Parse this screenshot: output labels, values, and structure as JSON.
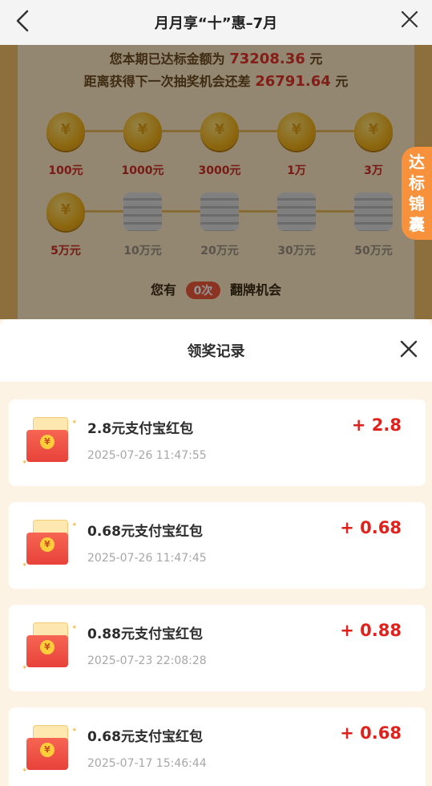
{
  "header": {
    "title": "月月享“十”惠–7月",
    "back_icon": "chevron-left-icon",
    "close_icon": "close-icon"
  },
  "progress": {
    "line1_prefix": "您本期已达标金额为",
    "line1_amount": "73208.36",
    "line1_suffix": "元",
    "line2_prefix": "距离获得下一次抽奖机会还差",
    "line2_amount": "26791.64",
    "line2_suffix": "元"
  },
  "milestones_row1": [
    {
      "label": "100元",
      "reached": true
    },
    {
      "label": "1000元",
      "reached": true
    },
    {
      "label": "3000元",
      "reached": true
    },
    {
      "label": "1万",
      "reached": true
    },
    {
      "label": "3万",
      "reached": true
    }
  ],
  "milestones_row2": [
    {
      "label": "5万元",
      "reached": true
    },
    {
      "label": "10万元",
      "reached": false
    },
    {
      "label": "20万元",
      "reached": false
    },
    {
      "label": "30万元",
      "reached": false
    },
    {
      "label": "50万元",
      "reached": false
    }
  ],
  "chance": {
    "prefix": "您有",
    "count": "0次",
    "suffix": "翻牌机会"
  },
  "side_tab": {
    "label": "达标锦囊"
  },
  "sheet": {
    "title": "领奖记录",
    "close_icon": "close-icon"
  },
  "records": [
    {
      "title": "2.8元支付宝红包",
      "time": "2025-07-26 11:47:55",
      "amount": "+ 2.8"
    },
    {
      "title": "0.68元支付宝红包",
      "time": "2025-07-26 11:47:45",
      "amount": "+ 0.68"
    },
    {
      "title": "0.88元支付宝红包",
      "time": "2025-07-23 22:08:28",
      "amount": "+ 0.88"
    },
    {
      "title": "0.68元支付宝红包",
      "time": "2025-07-17 15:46:44",
      "amount": "+ 0.68"
    }
  ],
  "colors": {
    "accent_red": "#e0221c",
    "side_tab_orange": "#f7913c",
    "sheet_background": "#fdf3e4"
  }
}
